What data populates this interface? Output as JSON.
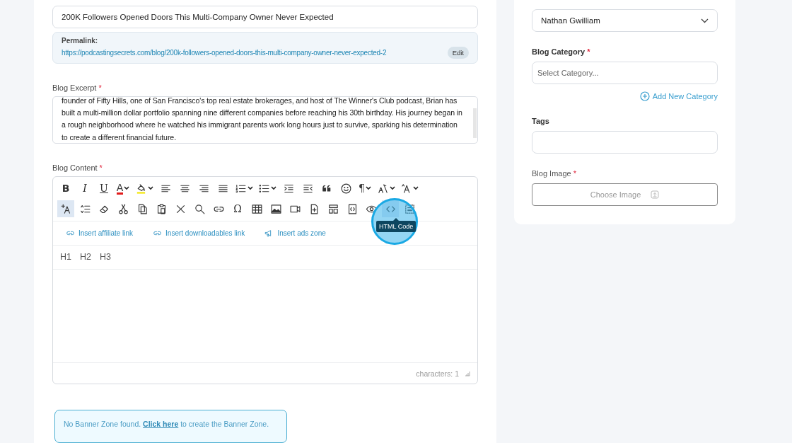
{
  "title_field": {
    "value": "200K Followers Opened Doors This Multi-Company  Owner Never Expected"
  },
  "permalink": {
    "label": "Permalink:",
    "url": "https://podcastingsecrets.com/blog/200k-followers-opened-doors-this-multi-company-owner-never-expected-2",
    "edit": "Edit"
  },
  "excerpt": {
    "label": "Blog Excerpt",
    "required_mark": "*",
    "value": "founder of Fifty Hills, one of San Francisco's top real estate brokerages, and host of The Winner's Club podcast, Brian has built a multi-million dollar portfolio spanning nine different companies before reaching his 30th birthday. His journey began in a rough neighborhood where he watched his immigrant parents work long hours just to survive, sparking his determination to create a different financial future."
  },
  "content": {
    "label": "Blog Content",
    "required_mark": "*",
    "toolbar": [
      [
        {
          "kind": "bold",
          "glyph": "B",
          "dropdown": false
        },
        {
          "kind": "italic",
          "glyph": "I",
          "dropdown": false
        },
        {
          "kind": "underline",
          "glyph": "U",
          "dropdown": false
        },
        {
          "kind": "font-color",
          "glyph": "A",
          "dropdown": true
        },
        {
          "kind": "highlight",
          "dropdown": true
        },
        {
          "kind": "align-left",
          "dropdown": false
        },
        {
          "kind": "align-center",
          "dropdown": false
        },
        {
          "kind": "align-right",
          "dropdown": false
        },
        {
          "kind": "justify",
          "dropdown": false
        },
        {
          "kind": "ordered-list",
          "dropdown": true
        },
        {
          "kind": "bullet-list",
          "dropdown": true
        },
        {
          "kind": "indent",
          "dropdown": false
        },
        {
          "kind": "outdent",
          "dropdown": false
        },
        {
          "kind": "quote",
          "dropdown": false
        },
        {
          "kind": "emoji",
          "dropdown": false
        },
        {
          "kind": "paragraph",
          "glyph": "¶",
          "dropdown": true
        },
        {
          "kind": "text-style",
          "dropdown": true
        },
        {
          "kind": "font-size",
          "dropdown": true
        }
      ],
      [
        {
          "kind": "clear-format",
          "selected": true
        },
        {
          "kind": "line-height",
          "selected": false
        },
        {
          "kind": "eraser",
          "selected": false
        },
        {
          "kind": "scissors",
          "selected": false
        },
        {
          "kind": "copy",
          "selected": false
        },
        {
          "kind": "paste",
          "selected": false
        },
        {
          "kind": "remove",
          "selected": false
        },
        {
          "kind": "search",
          "selected": false
        },
        {
          "kind": "link",
          "selected": false
        },
        {
          "kind": "special-char",
          "glyph": "Ω",
          "selected": false
        },
        {
          "kind": "table",
          "selected": false
        },
        {
          "kind": "image",
          "selected": false
        },
        {
          "kind": "video",
          "selected": false
        },
        {
          "kind": "file",
          "selected": false
        },
        {
          "kind": "template",
          "selected": false
        },
        {
          "kind": "code-block",
          "selected": false
        },
        {
          "kind": "eye",
          "selected": false
        },
        {
          "kind": "code",
          "selected": true,
          "tooltip": "HTML Code"
        },
        {
          "kind": "select-all",
          "selected": false
        }
      ]
    ],
    "inserts": [
      {
        "kind": "link",
        "label": "Insert affiliate link"
      },
      {
        "kind": "link",
        "label": "Insert downloadables link"
      },
      {
        "kind": "megaphone",
        "label": "Insert ads zone"
      }
    ],
    "headings": [
      "H1",
      "H2",
      "H3"
    ],
    "counter": "characters: 1"
  },
  "banner": {
    "before": "No Banner Zone found. ",
    "link": "Click here",
    "after": " to create the Banner Zone."
  },
  "author": {
    "value": "Nathan Gwilliam"
  },
  "category": {
    "label": "Blog Category",
    "required_mark": "*",
    "placeholder": "Select Category...",
    "add": "Add New Category"
  },
  "tags": {
    "label": "Tags"
  },
  "image": {
    "label": "Blog Image",
    "required_mark": "*",
    "button": "Choose Image"
  }
}
